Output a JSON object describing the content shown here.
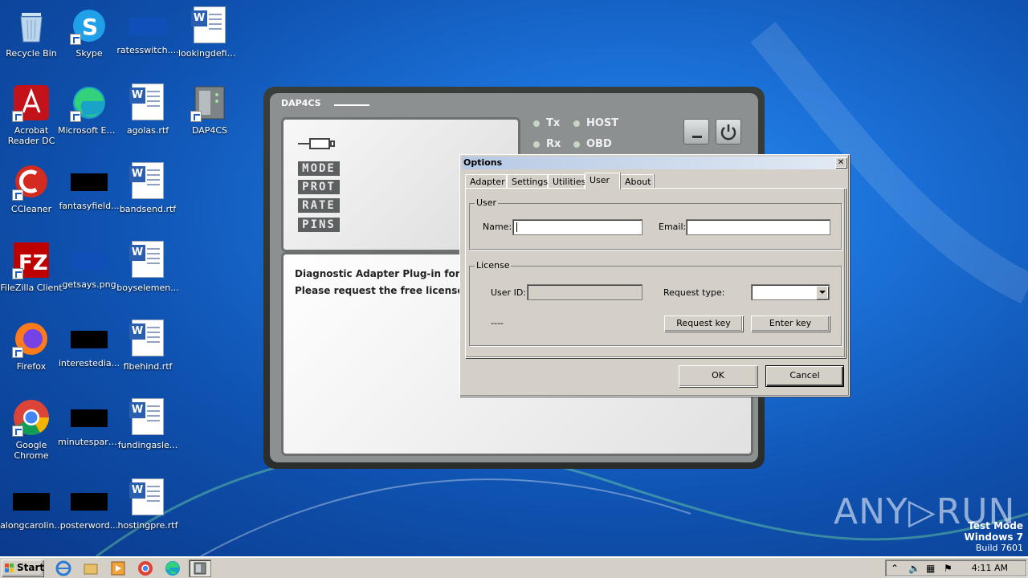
{
  "desktop": {
    "icons": [
      {
        "label": "Recycle Bin"
      },
      {
        "label": "Skype"
      },
      {
        "label": "ratesswitch...."
      },
      {
        "label": "lookingdefini..."
      },
      {
        "label": "Acrobat Reader DC"
      },
      {
        "label": "Microsoft Edge"
      },
      {
        "label": "agolas.rtf"
      },
      {
        "label": "DAP4CS"
      },
      {
        "label": "CCleaner"
      },
      {
        "label": "fantasyfield..."
      },
      {
        "label": "bandsend.rtf"
      },
      {
        "label": "FileZilla Client"
      },
      {
        "label": "getsays.png"
      },
      {
        "label": "boyselemen..."
      },
      {
        "label": "Firefox"
      },
      {
        "label": "interestedia..."
      },
      {
        "label": "flbehind.rtf"
      },
      {
        "label": "Google Chrome"
      },
      {
        "label": "minutespark..."
      },
      {
        "label": "fundingasle..."
      },
      {
        "label": "alongcarolin..."
      },
      {
        "label": "posterword..."
      },
      {
        "label": "hostingpre.rtf"
      }
    ]
  },
  "app": {
    "title": "DAP4CS",
    "tags": [
      "MODE",
      "PROT",
      "RATE",
      "PINS"
    ],
    "leds": {
      "tx": "Tx",
      "rx": "Rx",
      "host": "HOST",
      "obd": "OBD"
    },
    "message": "Diagnostic Adapter Plug-in for Ca\nPlease request the free license k"
  },
  "dialog": {
    "title": "Options",
    "close": "✕",
    "tabs": [
      "Adapter",
      "Settings",
      "Utilities",
      "User",
      "About"
    ],
    "active_tab": "User",
    "user_group": "User",
    "name_label": "Name:",
    "name_value": "",
    "email_label": "Email:",
    "email_value": "",
    "license_group": "License",
    "userid_label": "User ID:",
    "userid_value": "",
    "request_type_label": "Request type:",
    "request_type_value": "",
    "status": "----",
    "request_key": "Request key",
    "enter_key": "Enter key",
    "ok": "OK",
    "cancel": "Cancel"
  },
  "watermark": {
    "text": "ANY▷RUN",
    "test_mode": "Test Mode",
    "os": "Windows 7",
    "build": "Build 7601"
  },
  "taskbar": {
    "start": "Start",
    "clock": "4:11 AM"
  }
}
